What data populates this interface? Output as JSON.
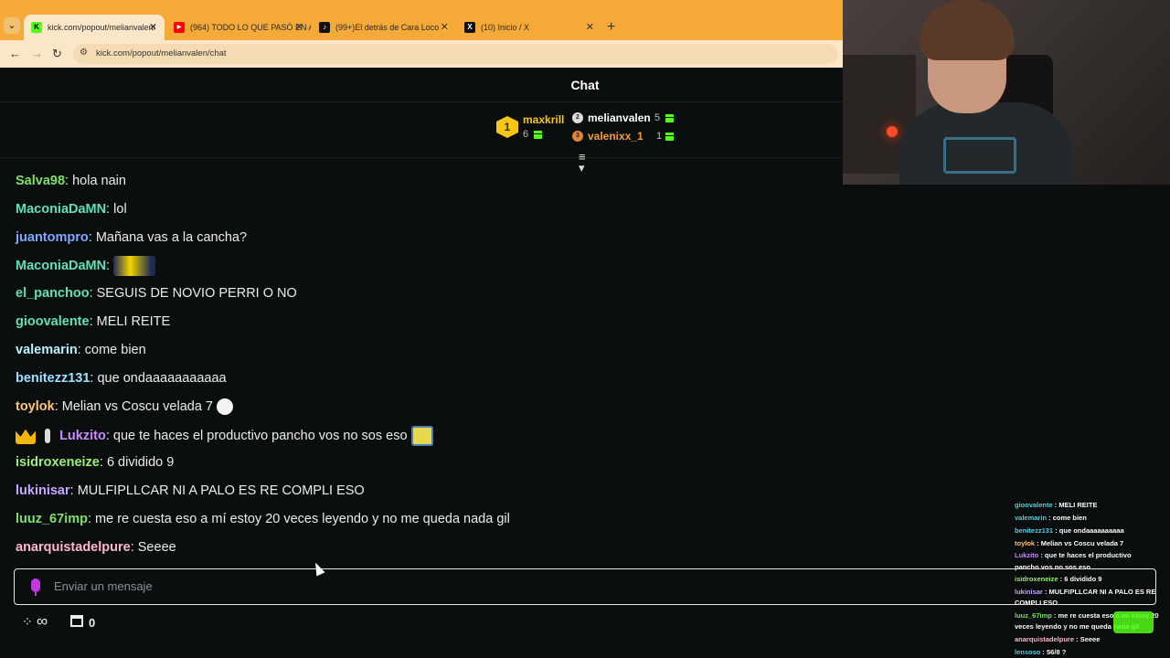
{
  "browser": {
    "tabs": [
      {
        "title": "kick.com/popout/melianvalen/",
        "favicon": "K",
        "active": true
      },
      {
        "title": "(964) TODO LO QUE PASÓ EN A",
        "favicon": "▶",
        "active": false
      },
      {
        "title": "(99+)El detrás de Cara Loco ⚡",
        "favicon": "♪",
        "active": false
      },
      {
        "title": "(10) Inicio / X",
        "favicon": "X",
        "active": false
      }
    ],
    "url": "kick.com/popout/melianvalen/chat"
  },
  "chat": {
    "title": "Chat",
    "input_placeholder": "Enviar un mensaje",
    "points_value": "∞",
    "store_count": "0"
  },
  "leaderboard": {
    "first": {
      "rank": "1",
      "name": "maxkrill",
      "gifts": "6"
    },
    "second": {
      "rank": "2",
      "name": "melianvalen",
      "gifts": "5"
    },
    "third": {
      "rank": "3",
      "name": "valenixx_1",
      "gifts": "1"
    }
  },
  "messages": [
    {
      "user": "Salva98",
      "text": "hola nain",
      "color": "#7ee06a"
    },
    {
      "user": "MaconiaDaMN",
      "text": "lol",
      "color": "#5fe0b8"
    },
    {
      "user": "juantompro",
      "text": "Mañana vas a la cancha?",
      "color": "#7ea8ff"
    },
    {
      "user": "MaconiaDaMN",
      "text": "",
      "color": "#5fe0b8",
      "emote": "minion"
    },
    {
      "user": "el_panchoo",
      "text": "SEGUIS DE NOVIO PERRI O NO",
      "color": "#5fe0b8"
    },
    {
      "user": "gioovalente",
      "text": "MELI REITE",
      "color": "#5fe0b8"
    },
    {
      "user": "valemarin",
      "text": "come bien",
      "color": "#b8f0ff"
    },
    {
      "user": "benitezz131",
      "text": "que ondaaaaaaaaaaa",
      "color": "#9ee0ff"
    },
    {
      "user": "toylok",
      "text": "Melian vs Coscu velada 7",
      "color": "#ffc478",
      "emote": "ghost"
    },
    {
      "user": "Lukzito",
      "text": "que te haces el productivo pancho vos no sos eso",
      "color": "#c88cff",
      "emote": "sponge",
      "badges": true
    },
    {
      "user": "isidroxeneize",
      "text": "6 dividido 9",
      "color": "#9cf078"
    },
    {
      "user": "lukinisar",
      "text": "MULFIPLLCAR NI A PALO ES RE COMPLI ESO",
      "color": "#c8a8ff"
    },
    {
      "user": "luuz_67imp",
      "text": "me re cuesta eso a mí estoy 20 veces leyendo y no me queda nada gil",
      "color": "#7ee06a"
    },
    {
      "user": "anarquistadelpure",
      "text": "Seeee",
      "color": "#ffb8c8"
    }
  ],
  "overlay_messages": [
    {
      "user": "gioovalente",
      "text": "MELI REITE"
    },
    {
      "user": "valemarin",
      "text": "come bien"
    },
    {
      "user": "benitezz131",
      "text": "que ondaaaaaaaaaa"
    },
    {
      "user": "toylok",
      "text": "Melian vs Coscu velada 7"
    },
    {
      "user": "Lukzito",
      "text": "que te haces el productivo"
    },
    {
      "user": "",
      "text": "pancho vos no sos eso"
    },
    {
      "user": "isidroxeneize",
      "text": "6 dividido 9"
    },
    {
      "user": "lukinisar",
      "text": "MULFIPLLCAR NI A PALO ES RE"
    },
    {
      "user": "",
      "text": "COMPLI ESO"
    },
    {
      "user": "luuz_67imp",
      "text": "me re cuesta eso a mí estoy 20"
    },
    {
      "user": "",
      "text": "veces leyendo y no me queda nada gil"
    },
    {
      "user": "anarquistadelpure",
      "text": "Seeee"
    },
    {
      "user": "lensoso",
      "text": "56/8 ?"
    }
  ],
  "colors": {
    "accent": "#53fc18",
    "background": "#0b0e0f",
    "tabbar": "#f5a938"
  }
}
